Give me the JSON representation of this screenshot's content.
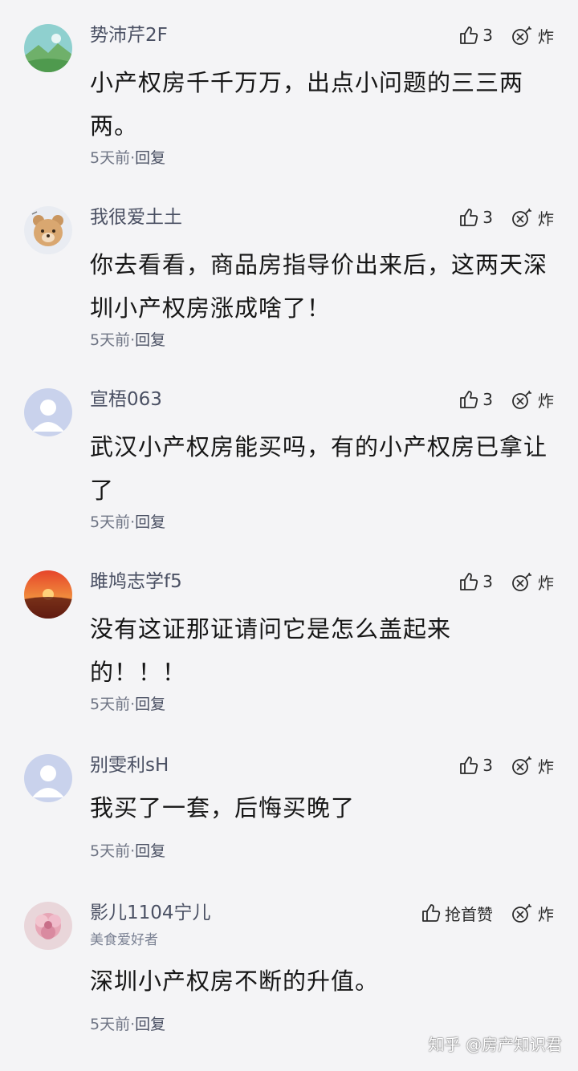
{
  "comments": [
    {
      "user": "势沛芹2F",
      "likes": "3",
      "bomb": "炸",
      "text": "小产权房千千万万，出点小问题的三三两两。",
      "time": "5天前",
      "sep": "·",
      "reply": "回复",
      "avatar": "landscape-avatar"
    },
    {
      "user": "我很爱土土",
      "likes": "3",
      "bomb": "炸",
      "text": "你去看看，商品房指导价出来后，这两天深圳小产权房涨成啥了！",
      "time": "5天前",
      "sep": "·",
      "reply": "回复",
      "avatar": "bear-avatar"
    },
    {
      "user": "宣梧063",
      "likes": "3",
      "bomb": "炸",
      "text": "武汉小产权房能买吗，有的小产权房已拿让了",
      "time": "5天前",
      "sep": "·",
      "reply": "回复",
      "avatar": "default-avatar"
    },
    {
      "user": "雎鸠志学f5",
      "likes": "3",
      "bomb": "炸",
      "text": "没有这证那证请问它是怎么盖起来的！！！",
      "time": "5天前",
      "sep": "·",
      "reply": "回复",
      "avatar": "sunset-avatar"
    },
    {
      "user": "别雯利sH",
      "likes": "3",
      "bomb": "炸",
      "text": "我买了一套，后悔买晚了",
      "time": "5天前",
      "sep": "·",
      "reply": "回复",
      "avatar": "default-avatar"
    },
    {
      "user": "影儿1104宁儿",
      "badge": "美食爱好者",
      "likes": "抢首赞",
      "bomb": "炸",
      "text": "深圳小产权房不断的升值。",
      "time": "5天前",
      "sep": "·",
      "reply": "回复",
      "avatar": "flower-avatar"
    }
  ],
  "watermark": "知乎 @房产知识君",
  "colors": {
    "background": "#f4f4f6",
    "username": "#4a5063",
    "meta": "#6e7484"
  }
}
